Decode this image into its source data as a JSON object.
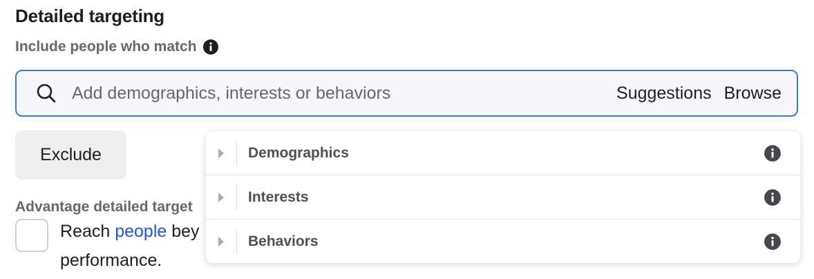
{
  "section": {
    "title": "Detailed targeting",
    "subtitle": "Include people who match"
  },
  "search": {
    "placeholder": "Add demographics, interests or behaviors",
    "value": "",
    "suggestions_label": "Suggestions",
    "browse_label": "Browse"
  },
  "exclude_label": "Exclude",
  "advantage": {
    "heading": "Advantage detailed target",
    "line1_prefix": "Reach ",
    "line1_link": "people",
    "line1_suffix": " bey",
    "line2": "performance."
  },
  "dropdown": {
    "items": [
      {
        "label": "Demographics",
        "icon": "info-icon"
      },
      {
        "label": "Interests",
        "icon": "info-icon"
      },
      {
        "label": "Behaviors",
        "icon": "info-icon"
      }
    ]
  },
  "colors": {
    "focus_border": "#3b79d8",
    "link": "#1f59c8",
    "muted_text": "#65676b",
    "primary_text": "#1c1e21"
  }
}
